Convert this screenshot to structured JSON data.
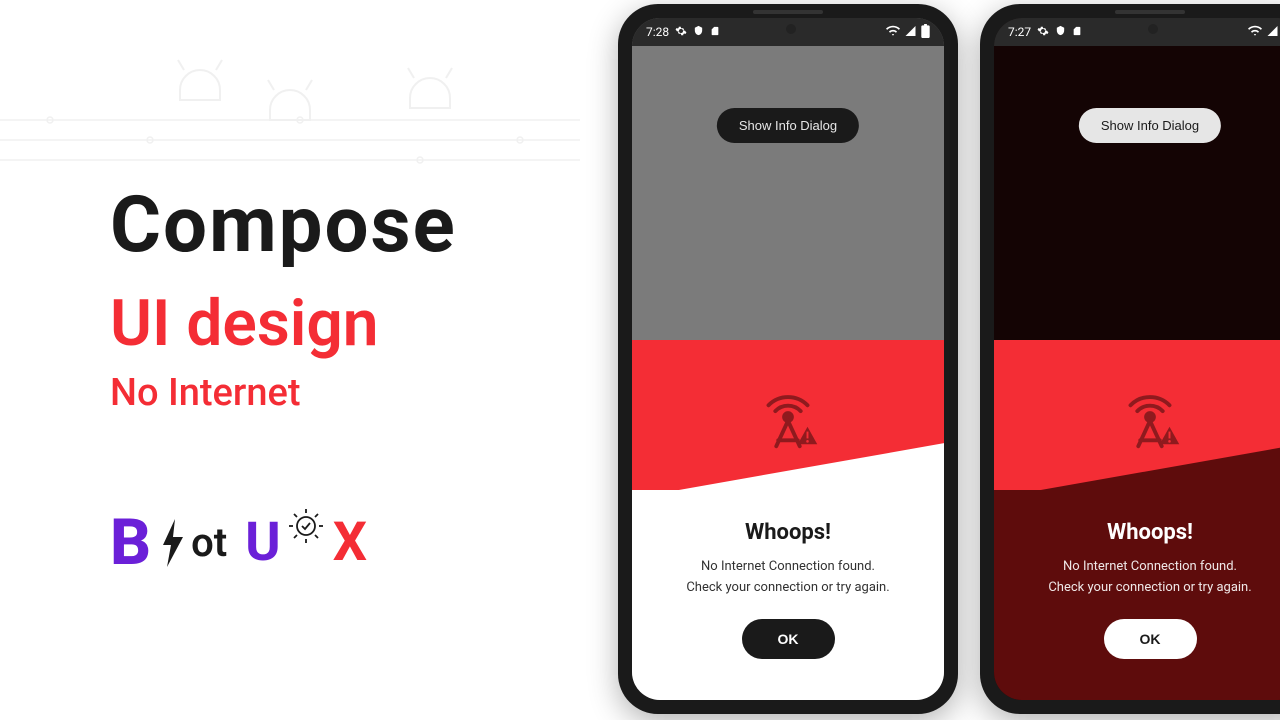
{
  "left": {
    "title1": "Compose",
    "title2": "UI design",
    "subtitle": "No Internet",
    "logo": {
      "b": "B",
      "ot": "ot",
      "u": "U",
      "x": "X"
    }
  },
  "phones": [
    {
      "statusbar": {
        "time": "7:28"
      },
      "button": "Show Info Dialog",
      "sheet": {
        "title": "Whoops!",
        "line1": "No Internet Connection found.",
        "line2": "Check your connection or try again.",
        "ok": "OK"
      }
    },
    {
      "statusbar": {
        "time": "7:27"
      },
      "button": "Show Info Dialog",
      "sheet": {
        "title": "Whoops!",
        "line1": "No Internet Connection found.",
        "line2": "Check your connection or try again.",
        "ok": "OK"
      }
    }
  ]
}
